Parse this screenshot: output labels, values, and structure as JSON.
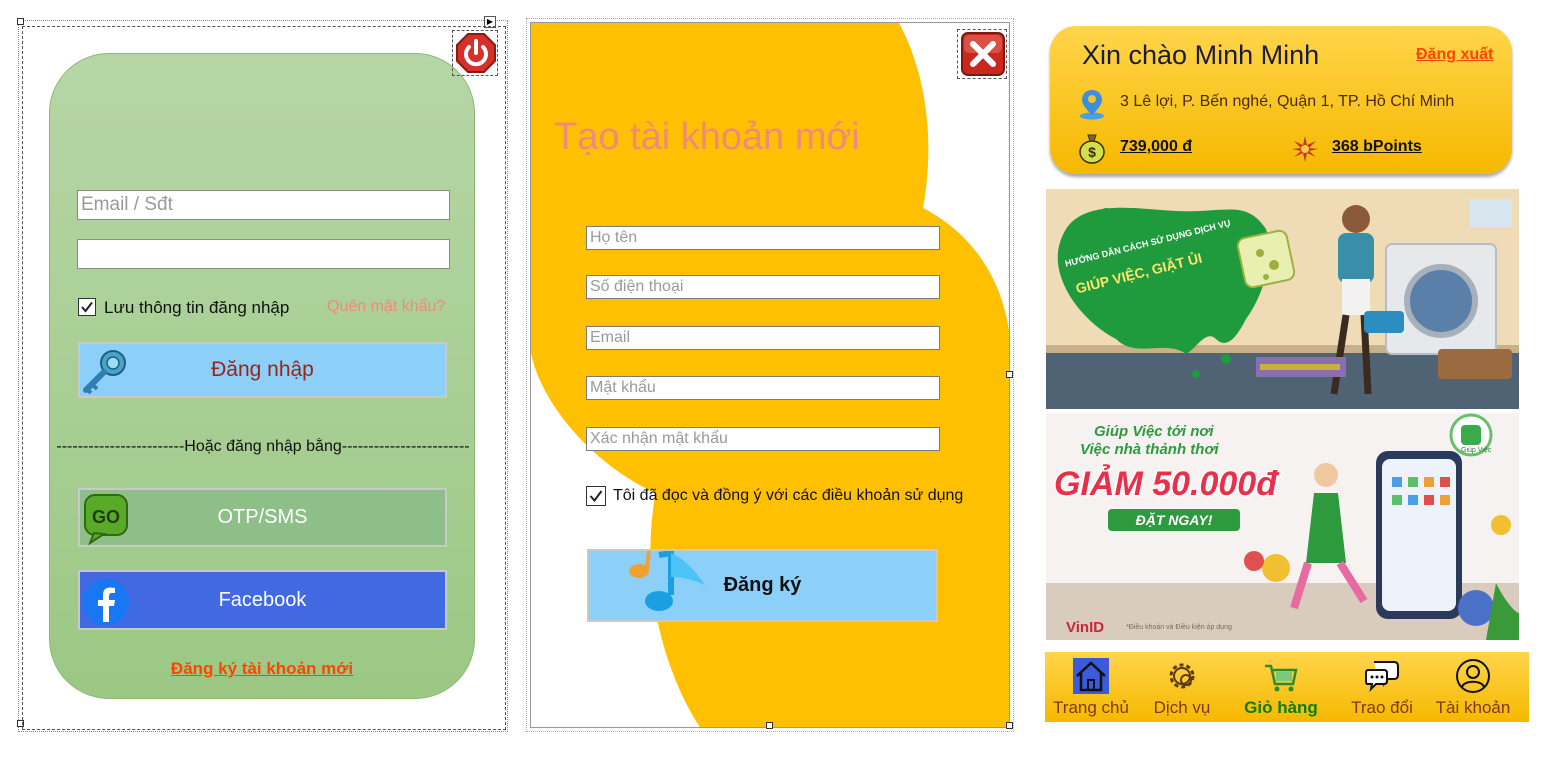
{
  "login": {
    "email_placeholder": "Email / Sđt",
    "password_value": "",
    "remember_label": "Lưu thông tin đăng nhập",
    "remember_checked": true,
    "forgot_label": "Quên mật khẩu?",
    "login_button": "Đăng nhập",
    "divider_text": "------------------------Hoặc đăng nhập bằng------------------------",
    "otp_button": "OTP/SMS",
    "facebook_button": "Facebook",
    "register_link": "Đăng ký tài khoản mới"
  },
  "register": {
    "title": "Tạo tài khoản mới",
    "fields": [
      {
        "placeholder": "Họ tên"
      },
      {
        "placeholder": "Số điện thoại"
      },
      {
        "placeholder": "Email"
      },
      {
        "placeholder": "Mật khẩu"
      },
      {
        "placeholder": "Xác nhận mật khẩu"
      }
    ],
    "terms_label": "Tôi đã đọc và đồng ý với các điều khoản sử dụng",
    "terms_checked": true,
    "submit_button": "Đăng ký"
  },
  "home": {
    "greeting": "Xin chào Minh Minh",
    "logout_link": "Đăng xuất",
    "address": "3 Lê lợi, P. Bến nghé, Quận 1, TP. Hồ Chí Minh",
    "balance": "739,000 đ",
    "points": "368 bPoints",
    "banner1": {
      "line1": "HƯỚNG DẪN CÁCH SỬ DỤNG DỊCH VỤ",
      "line2": "GIÚP VIỆC, GIẶT ỦI"
    },
    "banner2": {
      "line1": "Giúp Việc tới nơi",
      "line2": "Việc nhà thảnh thơi",
      "promo": "GIẢM 50.000đ",
      "cta": "ĐẶT NGAY!",
      "brand": "VinID",
      "app_badge": "Giúp Việc",
      "footnote": "*Điều khoản và Điều kiện áp dụng"
    },
    "nav": [
      {
        "label": "Trang chủ",
        "icon": "home-icon"
      },
      {
        "label": "Dịch vụ",
        "icon": "gear-icon"
      },
      {
        "label": "Giỏ hàng",
        "icon": "cart-icon"
      },
      {
        "label": "Trao đổi",
        "icon": "chat-icon"
      },
      {
        "label": "Tài khoản",
        "icon": "user-icon"
      }
    ]
  },
  "colors": {
    "login_card": "#a8cf92",
    "login_button": "#8ccff8",
    "otp_button": "#8fbf88",
    "facebook_button": "#4169e1",
    "register_yellow": "#fec000",
    "title_pink": "#f08a7a",
    "link_orange": "#ff4500",
    "nav_active": "#0b7d0b"
  }
}
